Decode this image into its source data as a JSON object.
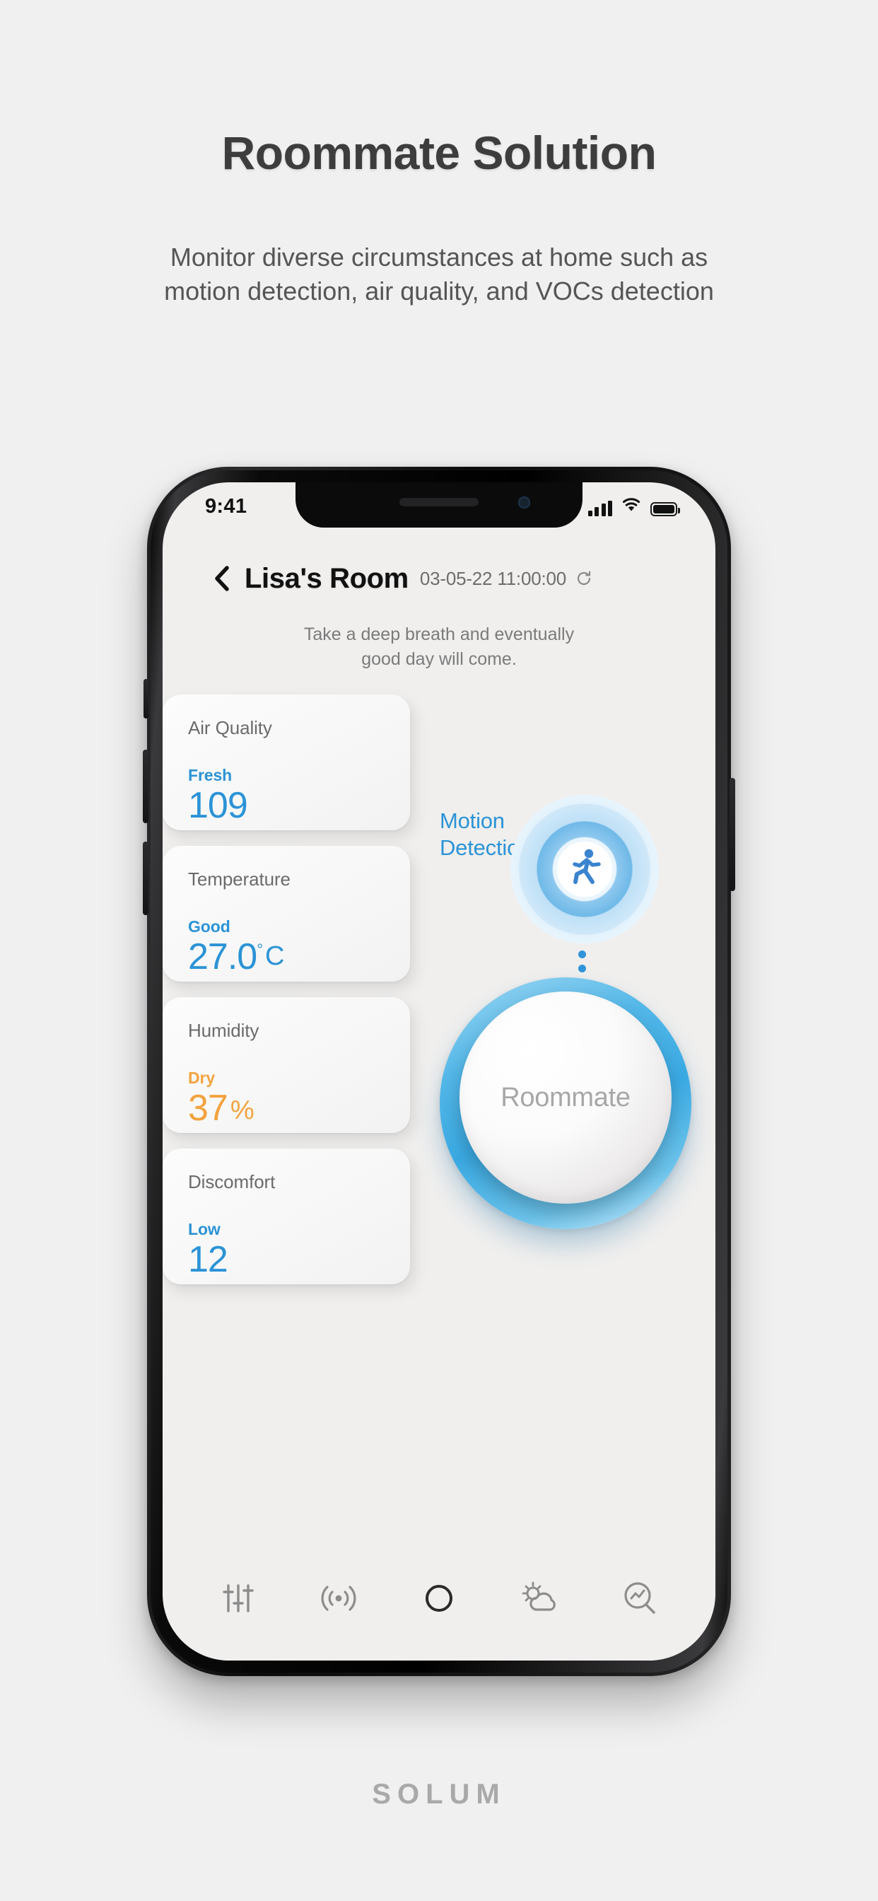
{
  "promo": {
    "title": "Roommate Solution",
    "subtitle_line1": "Monitor diverse circumstances at home such as",
    "subtitle_line2": "motion detection, air quality, and VOCs detection"
  },
  "status_bar": {
    "time": "9:41",
    "signal_icon": "cellular-signal-icon",
    "wifi_icon": "wifi-icon",
    "battery_icon": "battery-full-icon"
  },
  "app_header": {
    "back_icon": "chevron-left-icon",
    "room_title": "Lisa's Room",
    "timestamp": "03-05-22 11:00:00",
    "refresh_icon": "refresh-icon"
  },
  "quote": {
    "line1": "Take a deep breath and eventually",
    "line2": "good day will come."
  },
  "cards": [
    {
      "title": "Air Quality",
      "status": "Fresh",
      "value": "109",
      "unit": "",
      "degree": false,
      "color": "#2b93d6"
    },
    {
      "title": "Temperature",
      "status": "Good",
      "value": "27.0",
      "unit": "C",
      "degree": true,
      "color": "#2b93d6"
    },
    {
      "title": "Humidity",
      "status": "Dry",
      "value": "37",
      "unit": "%",
      "degree": false,
      "color": "#f2a33e"
    },
    {
      "title": "Discomfort",
      "status": "Low",
      "value": "12",
      "unit": "",
      "degree": false,
      "color": "#2b93d6"
    }
  ],
  "motion": {
    "label_line1": "Motion",
    "label_line2": "Detection",
    "icon": "running-person-icon",
    "overflow_icon": "more-vertical-icon",
    "accent": "#2b93d6"
  },
  "roommate_button": {
    "label": "Roommate",
    "ring_color": "#3aaae3"
  },
  "bottom_nav": [
    {
      "name": "settings-sliders-icon",
      "label": "Settings"
    },
    {
      "name": "signal-waves-icon",
      "label": "Signal"
    },
    {
      "name": "home-circle-icon",
      "label": "Home"
    },
    {
      "name": "weather-icon",
      "label": "Weather"
    },
    {
      "name": "analytics-search-icon",
      "label": "Analytics"
    }
  ],
  "footer": {
    "brand": "SOLUM"
  }
}
